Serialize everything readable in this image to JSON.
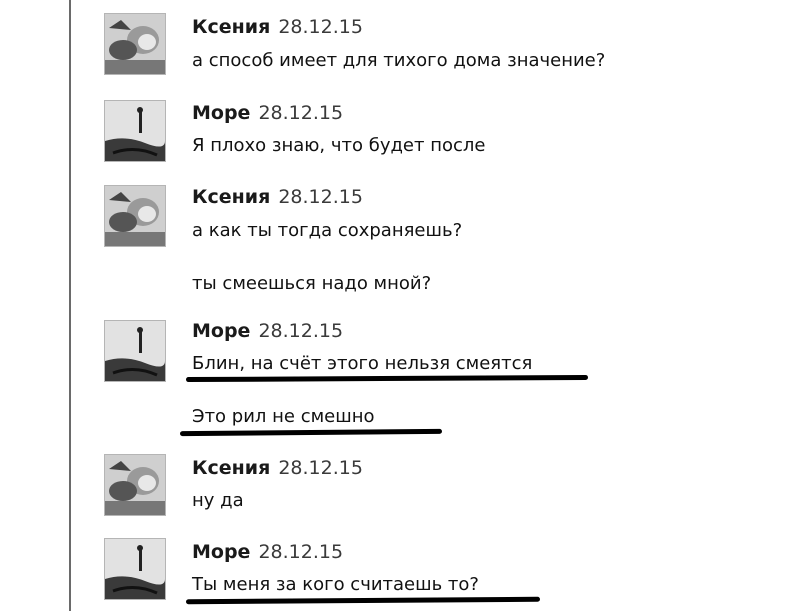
{
  "messages": [
    {
      "author": "Ксения",
      "date": "28.12.15",
      "avatar_icon": "girl-avatar",
      "lines": [
        "а способ имеет для тихого дома значение?"
      ]
    },
    {
      "author": "Море",
      "date": "28.12.15",
      "avatar_icon": "sea-avatar",
      "lines": [
        "Я плохо знаю, что будет после"
      ]
    },
    {
      "author": "Ксения",
      "date": "28.12.15",
      "avatar_icon": "girl-avatar",
      "lines": [
        "а как ты тогда сохраняешь?",
        "ты смеешься надо мной?"
      ]
    },
    {
      "author": "Море",
      "date": "28.12.15",
      "avatar_icon": "sea-avatar",
      "lines": [
        "Блин, на счёт этого нельзя смеятся",
        "Это рил не смешно"
      ]
    },
    {
      "author": "Ксения",
      "date": "28.12.15",
      "avatar_icon": "girl-avatar",
      "lines": [
        "ну да"
      ]
    },
    {
      "author": "Море",
      "date": "28.12.15",
      "avatar_icon": "sea-avatar",
      "lines": [
        "Ты меня за кого считаешь то?"
      ]
    }
  ]
}
